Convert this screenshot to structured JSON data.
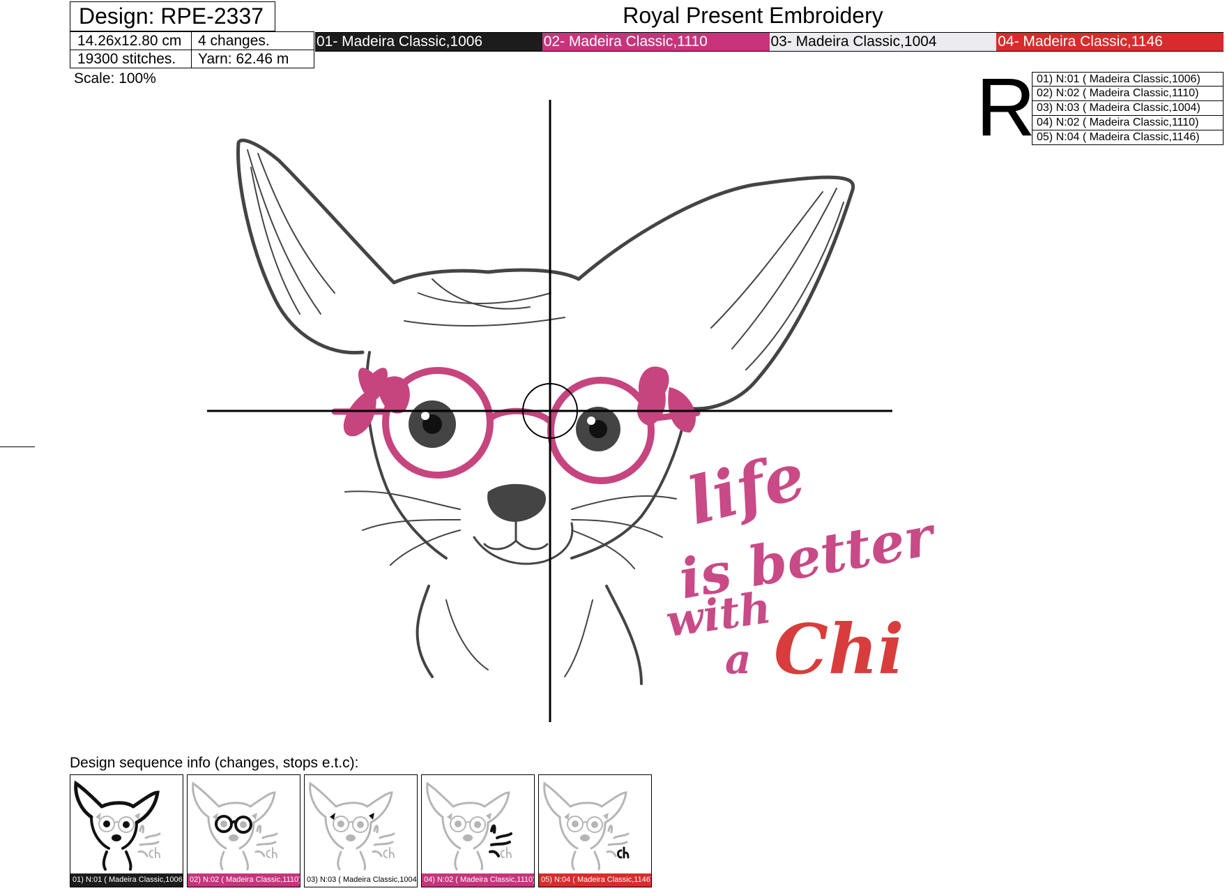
{
  "header": {
    "design_id": "Design: RPE-2337",
    "size": "14.26x12.80 cm",
    "changes": "4 changes.",
    "stitches": "19300 stitches.",
    "yarn": "Yarn: 62.46 m",
    "scale": "Scale: 100%",
    "title": "Royal Present Embroidery"
  },
  "colors": [
    {
      "label": "01- Madeira Classic,1006",
      "bg": "#1c1c1c",
      "fg": "#ffffff"
    },
    {
      "label": "02- Madeira Classic,1110",
      "bg": "#c6357c",
      "fg": "#ffffff"
    },
    {
      "label": "03- Madeira Classic,1004",
      "bg": "#ecebf0",
      "fg": "#000000"
    },
    {
      "label": "04- Madeira Classic,1146",
      "bg": "#d92b2b",
      "fg": "#ffffff"
    }
  ],
  "legend": {
    "mark": "R",
    "threads": [
      "01) N:01 ( Madeira Classic,1006)",
      "02) N:02 ( Madeira Classic,1110)",
      "03) N:03 ( Madeira Classic,1004)",
      "04) N:02 ( Madeira Classic,1110)",
      "05) N:04 ( Madeira Classic,1146)"
    ]
  },
  "design": {
    "text_lines": [
      "life",
      "is better",
      "with",
      "a",
      "Chi"
    ],
    "line_color": "#444444",
    "glasses_color": "#c6457f",
    "text_color": "#c84a86",
    "chi_color": "#d93c3c"
  },
  "sequence": {
    "label": "Design sequence info (changes, stops e.t.c):",
    "steps": [
      {
        "label": "01) N:01 ( Madeira Classic,1006)",
        "bg": "#1c1c1c",
        "fg": "#ffffff",
        "active": "outline"
      },
      {
        "label": "02) N:02 ( Madeira Classic,1110)",
        "bg": "#c6357c",
        "fg": "#ffffff",
        "active": "glasses"
      },
      {
        "label": "03) N:03 ( Madeira Classic,1004)",
        "bg": "#ffffff",
        "fg": "#000000",
        "active": "bows"
      },
      {
        "label": "04) N:02 ( Madeira Classic,1110)",
        "bg": "#c6357c",
        "fg": "#ffffff",
        "active": "text"
      },
      {
        "label": "05) N:04 ( Madeira Classic,1146)",
        "bg": "#d92b2b",
        "fg": "#ffffff",
        "active": "chi"
      }
    ]
  }
}
